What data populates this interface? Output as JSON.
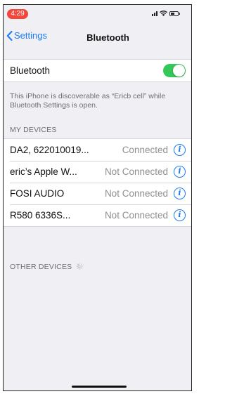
{
  "status_bar": {
    "time": "4:29",
    "time_pill_color": "#f2473a",
    "icons": [
      "cellular-signal-icon",
      "wifi-icon",
      "battery-icon"
    ]
  },
  "nav": {
    "back_label": "Settings",
    "title": "Bluetooth"
  },
  "bluetooth_toggle": {
    "label": "Bluetooth",
    "on": true,
    "color": "#34c759"
  },
  "footnote": "This iPhone is discoverable as “Ericb cell” while Bluetooth Settings is open.",
  "my_devices": {
    "header": "MY DEVICES",
    "items": [
      {
        "name": "DA2, 622010019...",
        "status": "Connected"
      },
      {
        "name": "eric’s Apple W...",
        "status": "Not Connected"
      },
      {
        "name": "FOSI AUDIO",
        "status": "Not Connected"
      },
      {
        "name": "R580 6336S...",
        "status": "Not Connected"
      }
    ]
  },
  "other_devices": {
    "header": "OTHER DEVICES",
    "searching": true
  },
  "accent_color": "#1a7cf5"
}
